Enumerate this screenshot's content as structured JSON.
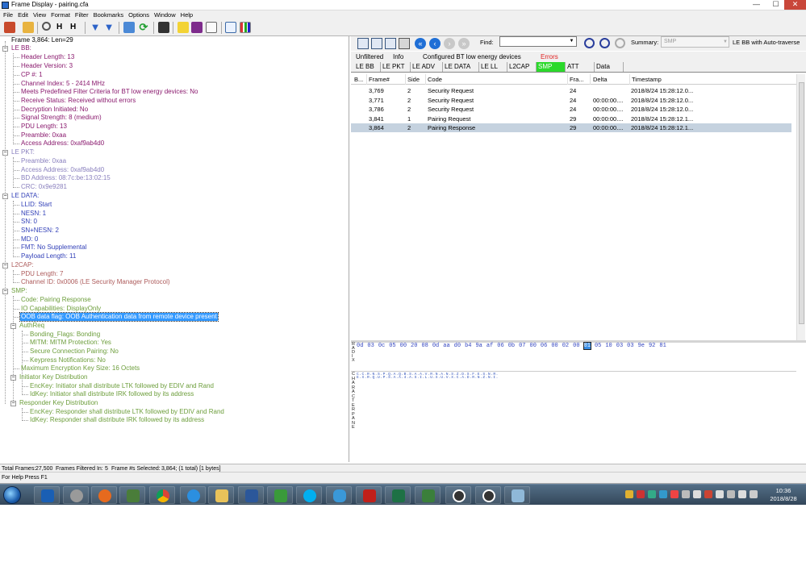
{
  "window": {
    "title": "Frame Display - pairing.cfa",
    "minimize": "—",
    "maximize": "☐",
    "close": "✕"
  },
  "menu": [
    "File",
    "Edit",
    "View",
    "Format",
    "Filter",
    "Bookmarks",
    "Options",
    "Window",
    "Help"
  ],
  "toolbar_icons": [
    "home-icon",
    "folder-open-icon",
    "magnifier-icon",
    "hex-icon",
    "hex-plus-icon",
    "filter-icon",
    "filter-clear-icon",
    "layers-icon",
    "refresh-icon",
    "binoculars-icon",
    "note-icon",
    "bookmark-icon",
    "book-open-icon",
    "chart-line-icon",
    "chart-bar-icon"
  ],
  "tree": {
    "root": "Frame 3,864:  Len=29",
    "nodes": [
      {
        "label": "LE BB:",
        "color": "c-mag",
        "children": [
          "Header Length: 13",
          "Header Version: 3",
          "CP #: 1",
          "Channel Index:  5 - 2414 MHz",
          "Meets Predefined Filter Criteria for BT low energy devices: No",
          "Receive Status: Received without errors",
          "Decryption Initiated: No",
          "Signal Strength: 8 (medium)",
          "PDU Length: 13",
          "Preamble: 0xaa",
          "Access Address: 0xaf9ab4d0"
        ]
      },
      {
        "label": "LE PKT:",
        "color": "c-lav",
        "children": [
          "Preamble: 0xaa",
          "Access Address: 0xaf9ab4d0",
          "BD Address: 08:7c:be:13:02:15",
          "CRC: 0x9e9281"
        ]
      },
      {
        "label": "LE DATA:",
        "color": "c-blu",
        "children": [
          "LLID: Start",
          "NESN: 1",
          "SN: 0",
          "SN+NESN: 2",
          "MD: 0",
          "FMT: No Supplemental",
          "Payload Length: 11"
        ]
      },
      {
        "label": "L2CAP:",
        "color": "c-brn",
        "children": [
          "PDU Length: 7",
          "Channel ID: 0x0006  (LE Security Manager Protocol)"
        ]
      },
      {
        "label": "SMP:",
        "color": "c-grn"
      }
    ],
    "smp": {
      "code": "Code: Pairing Response",
      "io": "IO Capabilities: DisplayOnly",
      "oob": "OOB data flag: OOB Authentication data from remote device present",
      "authreq": "AuthReq",
      "auth_children": [
        "Bonding_Flags: Bonding",
        "MITM: MITM Protection:  Yes",
        "Secure Connection Pairing: No",
        "Keypress Notifications: No"
      ],
      "maxkey": "Maximum Encryption Key Size: 16 Octets",
      "init": "Initiator Key Distribution",
      "init_children": [
        "EncKey: Initiator shall distribute LTK followed by EDIV and Rand",
        "IdKey: Initiator shall distribute IRK followed by its address"
      ],
      "resp": "Responder Key Distribution",
      "resp_children": [
        "EncKey: Responder shall distribute LTK followed by EDIV and Rand",
        "IdKey: Responder shall distribute IRK followed by its address"
      ]
    }
  },
  "right": {
    "find_label": "Find:",
    "find_value": "",
    "summary_label": "Summary:",
    "summary_value": "SMP",
    "summary_extra": "LE BB with Auto-traverse",
    "tabs1": [
      "Unfiltered",
      "Info",
      "Configured BT low energy devices",
      "Errors"
    ],
    "tabs2": [
      "LE BB",
      "LE PKT",
      "LE ADV",
      "LE DATA",
      "LE LL",
      "L2CAP",
      "SMP",
      "ATT",
      "Data"
    ],
    "active_tab": "SMP",
    "columns": [
      "B...",
      "Frame#",
      "Side",
      "Code",
      "Fra...",
      "Delta",
      "Timestamp"
    ],
    "rows": [
      {
        "frame": "3,769",
        "side": "2",
        "code": "Security Request",
        "fra": "24",
        "delta": "",
        "ts": "2018/8/24 15:28:12.0..."
      },
      {
        "frame": "3,771",
        "side": "2",
        "code": "Security Request",
        "fra": "24",
        "delta": "00:00:00....",
        "ts": "2018/8/24 15:28:12.0..."
      },
      {
        "frame": "3,786",
        "side": "2",
        "code": "Security Request",
        "fra": "24",
        "delta": "00:00:00....",
        "ts": "2018/8/24 15:28:12.0..."
      },
      {
        "frame": "3,841",
        "side": "1",
        "code": "Pairing Request",
        "fra": "29",
        "delta": "00:00:00....",
        "ts": "2018/8/24 15:28:12.1..."
      },
      {
        "frame": "3,864",
        "side": "2",
        "code": "Pairing Response",
        "fra": "29",
        "delta": "00:00:00....",
        "ts": "2018/8/24 15:28:12.1..."
      }
    ],
    "hex_label": "RADIX",
    "hex_bytes": [
      "0d",
      "03",
      "0c",
      "05",
      "00",
      "20",
      "08",
      "0d",
      "aa",
      "d0",
      "b4",
      "9a",
      "af",
      "06",
      "0b",
      "07",
      "00",
      "06",
      "00",
      "02",
      "00",
      "01",
      "05",
      "10",
      "03",
      "03",
      "9e",
      "92",
      "81"
    ],
    "hex_highlight": 21,
    "ascii_label": "CHARACTER PANE",
    "ascii_line1": "C.C.R.N.S.P.Q.A.Q.B.S.A.A.V.R.N.A.N.S.Z.D.S.F.E.S.N.R.",
    "ascii_line2": "E.X.R.Q.U.P.S.A.A.4.A.S.I.L.U.X.U.V.X.C.A.D.R.N.Z.N.I."
  },
  "status": {
    "total_label": "Total Frames:",
    "total_value": "27,500",
    "filtered_label": "Frames Filtered In:",
    "filtered_value": "5",
    "selected_label": "Frame #s Selected:",
    "selected_value": "3,864; (1 total) [1 bytes]",
    "help": "For Help Press F1"
  },
  "taskbar": {
    "apps": [
      "outlook-icon",
      "settings-app-icon",
      "firefox-icon",
      "sound-recorder-icon",
      "chrome-icon",
      "ie-icon",
      "explorer-icon",
      "word-icon",
      "visio-icon",
      "skype-icon",
      "sogou-icon",
      "acrobat-icon",
      "excel-icon",
      "evernote-icon",
      "wireless-tool-icon",
      "wireless-tool-2-icon",
      "frontline-icon"
    ],
    "time": "10:36",
    "date": "2018/8/28"
  },
  "colors": {
    "accent_tab": "#2bd92b",
    "selection": "#3399ff",
    "row_highlight": "#c5d2df",
    "errors": "#e02020"
  }
}
